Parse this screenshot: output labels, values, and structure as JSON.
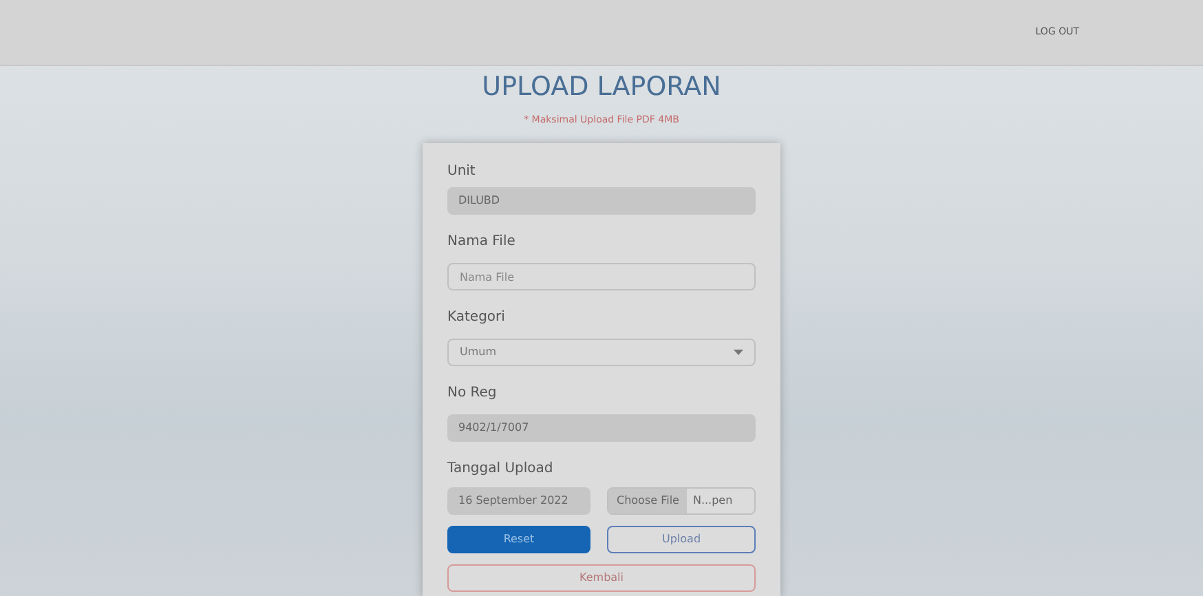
{
  "nav": {
    "logout": "LOG OUT"
  },
  "title": "UPLOAD LAPORAN",
  "note": "* Maksimal Upload File PDF 4MB",
  "form": {
    "unit": {
      "label": "Unit",
      "value": "DILUBD"
    },
    "name_file": {
      "label": "Nama File",
      "placeholder": "Nama File"
    },
    "kategori": {
      "label": "Kategori",
      "value": "Umum"
    },
    "no_reg": {
      "label": "No Reg",
      "value": "9402/1/7007"
    },
    "tanggal": {
      "label": "Tanggal Upload",
      "value": "16 September 2022"
    },
    "file": {
      "button": "Choose File",
      "value": "N...pen"
    }
  },
  "buttons": {
    "reset": "Reset",
    "upload": "Upload",
    "back": "Kembali"
  }
}
